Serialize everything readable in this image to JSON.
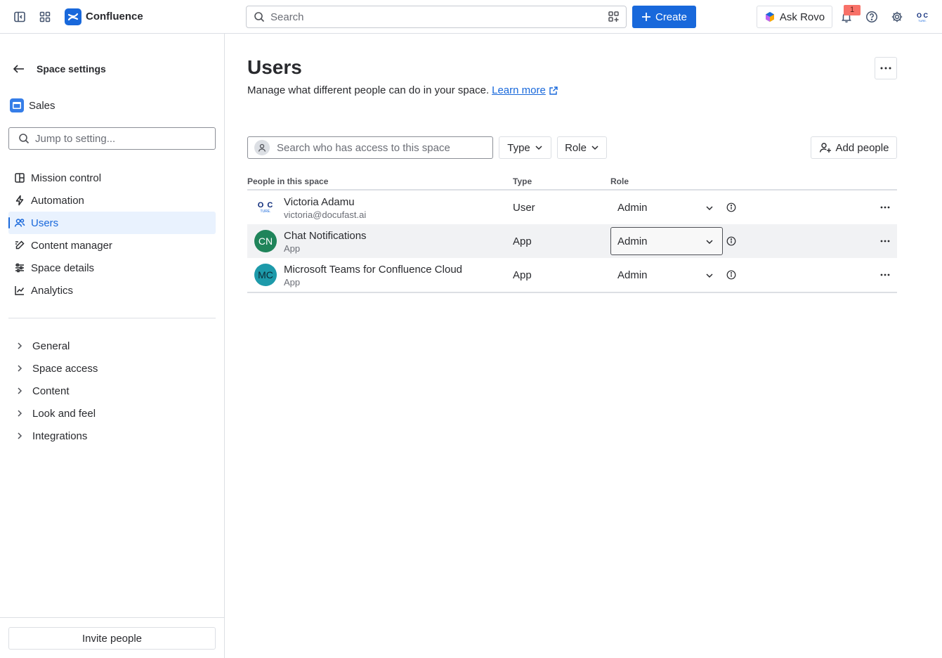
{
  "topbar": {
    "brand": "Confluence",
    "search_placeholder": "Search",
    "create_label": "Create",
    "rovo_label": "Ask Rovo",
    "notification_count": "1",
    "avatar_text_top": "O C",
    "avatar_text_bottom": "TURE."
  },
  "sidebar": {
    "back_title": "Space settings",
    "space_name": "Sales",
    "jump_placeholder": "Jump to setting...",
    "nav_items": [
      {
        "label": "Mission control",
        "icon": "layout-icon"
      },
      {
        "label": "Automation",
        "icon": "lightning-icon"
      },
      {
        "label": "Users",
        "icon": "people-icon",
        "active": true
      },
      {
        "label": "Content manager",
        "icon": "pencil-icon"
      },
      {
        "label": "Space details",
        "icon": "sliders-icon"
      },
      {
        "label": "Analytics",
        "icon": "chart-icon"
      }
    ],
    "groups": [
      "General",
      "Space access",
      "Content",
      "Look and feel",
      "Integrations"
    ],
    "invite_label": "Invite people"
  },
  "main": {
    "title": "Users",
    "description": "Manage what different people can do in your space.",
    "learn_more": "Learn more",
    "search_placeholder": "Search who has access to this space",
    "type_filter": "Type",
    "role_filter": "Role",
    "add_people": "Add people",
    "table": {
      "headers": [
        "People in this space",
        "Type",
        "Role"
      ],
      "rows": [
        {
          "name": "Victoria Adamu",
          "sub": "victoria@docufast.ai",
          "type": "User",
          "role": "Admin",
          "initials": "",
          "avatar_color": "#ffffff"
        },
        {
          "name": "Chat Notifications",
          "sub": "App",
          "type": "App",
          "role": "Admin",
          "initials": "CN",
          "avatar_color": "#1f845a"
        },
        {
          "name": "Microsoft Teams for Confluence Cloud",
          "sub": "App",
          "type": "App",
          "role": "Admin",
          "initials": "MC",
          "avatar_color": "#1d9aaa"
        }
      ]
    }
  },
  "colors": {
    "accent": "#1868db",
    "active_bg": "#e9f2fe",
    "border": "#dcdfe4"
  }
}
